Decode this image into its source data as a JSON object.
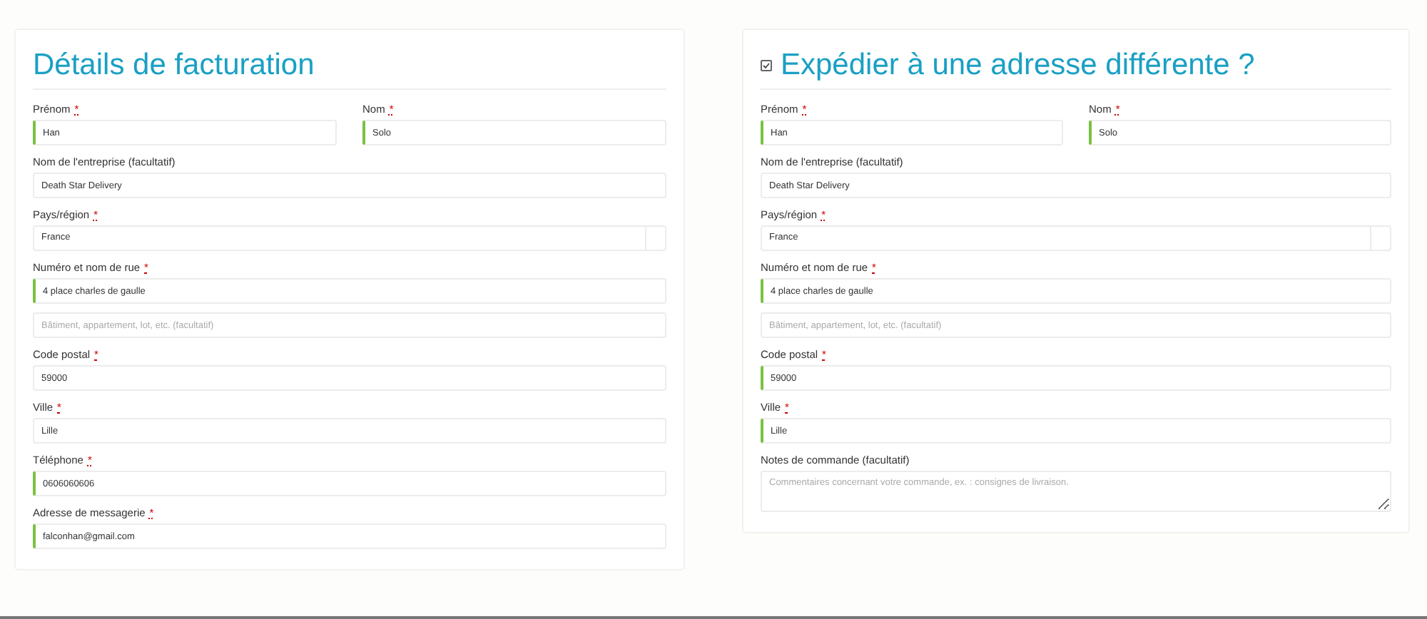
{
  "billing": {
    "title": "Détails de facturation",
    "rows": [
      {
        "fields": [
          {
            "kind": "text",
            "label": "Prénom",
            "mark": "*",
            "value": "Han",
            "valid": true
          },
          {
            "kind": "text",
            "label": "Nom",
            "mark": "*",
            "value": "Solo",
            "valid": true
          }
        ]
      },
      {
        "fields": [
          {
            "kind": "text",
            "label": "Nom de l'entreprise (facultatif)",
            "value": "Death Star Delivery",
            "valid": false
          }
        ]
      },
      {
        "fields": [
          {
            "kind": "select",
            "label": "Pays/région",
            "mark": "*",
            "value": "France",
            "valid": false
          }
        ]
      },
      {
        "fields": [
          {
            "kind": "text",
            "label": "Numéro et nom de rue",
            "mark": "*",
            "value": "4 place charles de gaulle",
            "valid": true
          }
        ]
      },
      {
        "fields": [
          {
            "kind": "text",
            "placeholder": "Bâtiment, appartement, lot, etc. (facultatif)",
            "valid": false
          }
        ]
      },
      {
        "fields": [
          {
            "kind": "text",
            "label": "Code postal",
            "mark": "*",
            "value": "59000",
            "valid": false
          }
        ]
      },
      {
        "fields": [
          {
            "kind": "text",
            "label": "Ville",
            "mark": "*",
            "value": "Lille",
            "valid": false
          }
        ]
      },
      {
        "fields": [
          {
            "kind": "text",
            "label": "Téléphone",
            "mark": "*",
            "value": "0606060606",
            "valid": true
          }
        ]
      },
      {
        "fields": [
          {
            "kind": "text",
            "label": "Adresse de messagerie",
            "mark": "*",
            "value": "falconhan@gmail.com",
            "valid": true
          }
        ]
      }
    ]
  },
  "shipping": {
    "title": "Expédier à une adresse différente ?",
    "checked": true,
    "rows": [
      {
        "fields": [
          {
            "kind": "text",
            "label": "Prénom",
            "mark": "*",
            "value": "Han",
            "valid": true
          },
          {
            "kind": "text",
            "label": "Nom",
            "mark": "*",
            "value": "Solo",
            "valid": true
          }
        ]
      },
      {
        "fields": [
          {
            "kind": "text",
            "label": "Nom de l'entreprise (facultatif)",
            "value": "Death Star Delivery",
            "valid": false
          }
        ]
      },
      {
        "fields": [
          {
            "kind": "select",
            "label": "Pays/région",
            "mark": "*",
            "value": "France",
            "valid": false
          }
        ]
      },
      {
        "fields": [
          {
            "kind": "text",
            "label": "Numéro et nom de rue",
            "mark": "*",
            "value": "4 place charles de gaulle",
            "valid": true
          }
        ]
      },
      {
        "fields": [
          {
            "kind": "text",
            "placeholder": "Bâtiment, appartement, lot, etc. (facultatif)",
            "valid": false
          }
        ]
      },
      {
        "fields": [
          {
            "kind": "text",
            "label": "Code postal",
            "mark": "*",
            "value": "59000",
            "valid": true
          }
        ]
      },
      {
        "fields": [
          {
            "kind": "text",
            "label": "Ville",
            "mark": "*",
            "value": "Lille",
            "valid": true
          }
        ]
      },
      {
        "fields": [
          {
            "kind": "textarea",
            "label": "Notes de commande (facultatif)",
            "placeholder": "Commentaires concernant votre commande, ex. : consignes de livraison.",
            "valid": false
          }
        ]
      }
    ]
  }
}
